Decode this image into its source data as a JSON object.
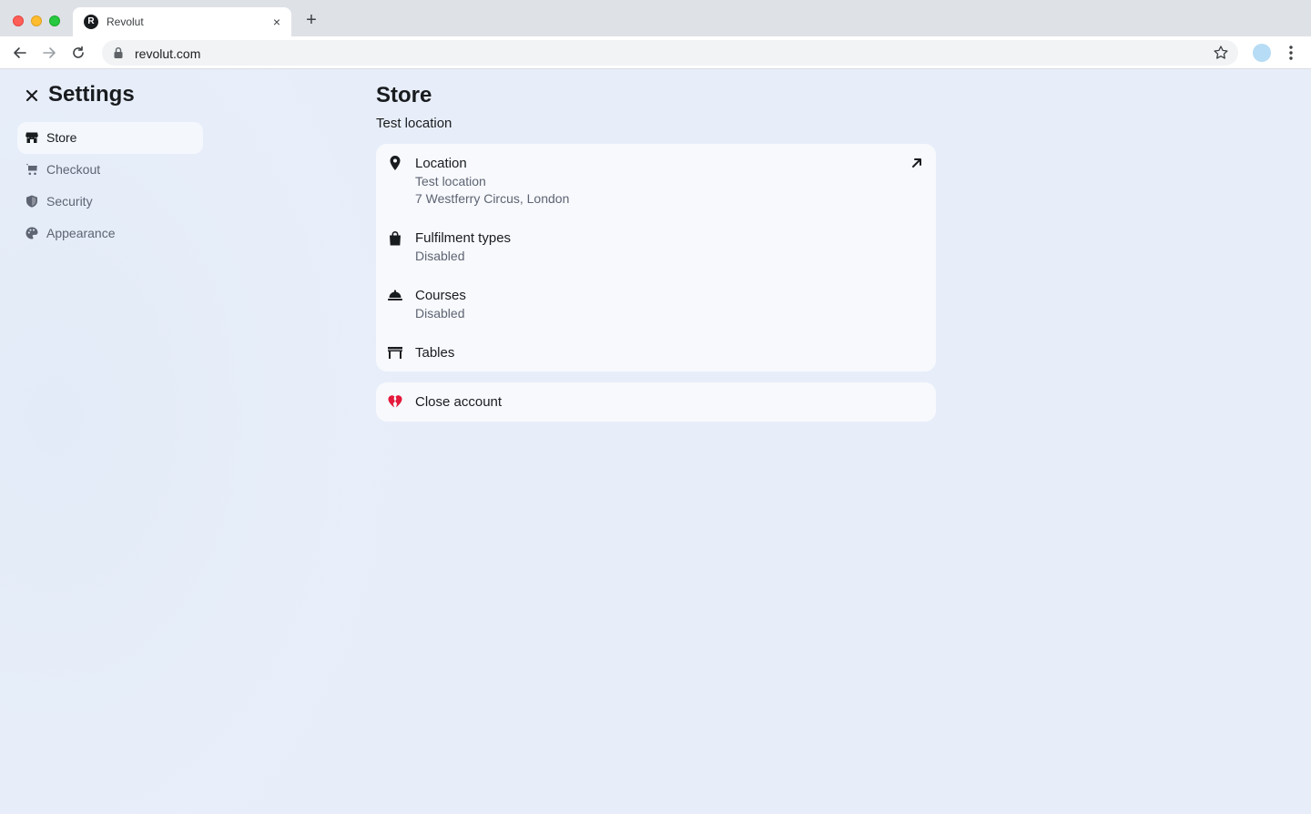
{
  "browser": {
    "tab_title": "Revolut",
    "tab_favicon_letter": "R",
    "tab_close": "×",
    "new_tab": "+",
    "url": "revolut.com"
  },
  "sidebar": {
    "title": "Settings",
    "items": [
      {
        "label": "Store",
        "icon": "store-icon",
        "active": true
      },
      {
        "label": "Checkout",
        "icon": "cart-icon",
        "active": false
      },
      {
        "label": "Security",
        "icon": "shield-icon",
        "active": false
      },
      {
        "label": "Appearance",
        "icon": "palette-icon",
        "active": false
      }
    ]
  },
  "main": {
    "title": "Store",
    "subtitle": "Test location",
    "rows": [
      {
        "title": "Location",
        "lines": [
          "Test location",
          "7 Westferry Circus, London"
        ],
        "icon": "location-pin-icon"
      },
      {
        "title": "Fulfilment types",
        "lines": [
          "Disabled"
        ],
        "icon": "bag-icon"
      },
      {
        "title": "Courses",
        "lines": [
          "Disabled"
        ],
        "icon": "cloche-icon"
      },
      {
        "title": "Tables",
        "lines": [],
        "icon": "table-icon"
      }
    ],
    "close_account": {
      "label": "Close account",
      "icon": "broken-heart-icon",
      "color": "#e5193c"
    }
  },
  "colors": {
    "page_bg": "#e8eef9",
    "card_bg": "#f7f9fd",
    "text_primary": "#191c1f",
    "text_secondary": "#5e6472"
  }
}
